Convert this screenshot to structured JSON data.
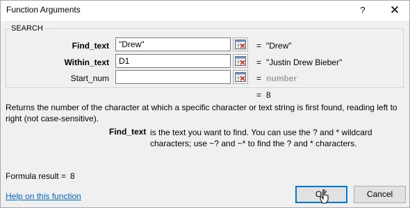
{
  "window": {
    "title": "Function Arguments",
    "help_glyph": "?",
    "close_glyph": "✕"
  },
  "function_group": {
    "name": "SEARCH",
    "arguments": [
      {
        "label": "Find_text",
        "value": "\"Drew\"",
        "result": "\"Drew\"",
        "required": true
      },
      {
        "label": "Within_text",
        "value": "D1",
        "result": "\"Justin Drew Bieber\"",
        "required": true
      },
      {
        "label": "Start_num",
        "value": "",
        "result": "number",
        "required": false
      }
    ],
    "equals": "=",
    "function_result": "8"
  },
  "description": "Returns the number of the character at which a specific character or text string is first found, reading left to right (not case-sensitive).",
  "argument_help": {
    "name": "Find_text",
    "text": "is the text you want to find. You can use the ? and * wildcard characters; use ~? and ~* to find the ? and * characters."
  },
  "formula_result": {
    "label": "Formula result =",
    "value": "8"
  },
  "footer": {
    "help_link": "Help on this function",
    "ok_label": "OK",
    "cancel_label": "Cancel"
  }
}
